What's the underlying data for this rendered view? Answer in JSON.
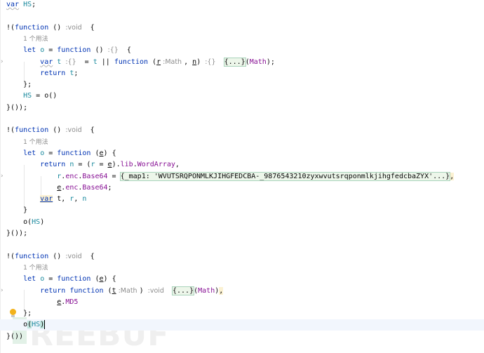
{
  "code": {
    "lines": [
      {
        "tokens": [
          {
            "t": "var",
            "c": "kw wavy"
          },
          {
            "t": " "
          },
          {
            "t": "HS",
            "c": "g"
          },
          {
            "t": ";"
          }
        ]
      },
      {
        "tokens": []
      },
      {
        "tokens": [
          {
            "t": "!("
          },
          {
            "t": "function",
            "c": "kw"
          },
          {
            "t": " () "
          },
          {
            "t": ":void",
            "c": "hint"
          },
          {
            "t": "  {"
          }
        ]
      },
      {
        "indent": 4,
        "tokens": [
          {
            "t": "1 个用法",
            "c": "usage"
          }
        ]
      },
      {
        "indent": 4,
        "tokens": [
          {
            "t": "let",
            "c": "kw"
          },
          {
            "t": " "
          },
          {
            "t": "o",
            "c": "g"
          },
          {
            "t": " = "
          },
          {
            "t": "function",
            "c": "kw"
          },
          {
            "t": " () "
          },
          {
            "t": ":{}",
            "c": "hint"
          },
          {
            "t": "  {"
          }
        ]
      },
      {
        "indent": 8,
        "fold": true,
        "tokens": [
          {
            "t": "var",
            "c": "kw wavy"
          },
          {
            "t": " "
          },
          {
            "t": "t",
            "c": "g"
          },
          {
            "t": " "
          },
          {
            "t": ":{}",
            "c": "hint"
          },
          {
            "t": "  = "
          },
          {
            "t": "t",
            "c": "g"
          },
          {
            "t": " || "
          },
          {
            "t": "function",
            "c": "kw"
          },
          {
            "t": " ("
          },
          {
            "t": "r",
            "c": "u"
          },
          {
            "t": " :Math ",
            "c": "hint"
          },
          {
            "t": ", "
          },
          {
            "t": "n",
            "c": "u"
          },
          {
            "t": ") "
          },
          {
            "t": ":{}",
            "c": "hint"
          },
          {
            "t": "  "
          },
          {
            "t": "{...}",
            "c": "fold"
          },
          {
            "t": "("
          },
          {
            "t": "Math",
            "c": "p"
          },
          {
            "t": ");"
          }
        ]
      },
      {
        "indent": 8,
        "tokens": [
          {
            "t": "return",
            "c": "kw"
          },
          {
            "t": " "
          },
          {
            "t": "t",
            "c": "g"
          },
          {
            "t": ";"
          }
        ]
      },
      {
        "indent": 4,
        "tokens": [
          {
            "t": "};"
          }
        ]
      },
      {
        "indent": 4,
        "tokens": [
          {
            "t": "HS",
            "c": "g"
          },
          {
            "t": " = "
          },
          {
            "t": "o",
            "c": "id"
          },
          {
            "t": "()"
          }
        ]
      },
      {
        "tokens": [
          {
            "t": "}());"
          }
        ]
      },
      {
        "tokens": []
      },
      {
        "tokens": [
          {
            "t": "!("
          },
          {
            "t": "function",
            "c": "kw"
          },
          {
            "t": " () "
          },
          {
            "t": ":void",
            "c": "hint"
          },
          {
            "t": "  {"
          }
        ]
      },
      {
        "indent": 4,
        "tokens": [
          {
            "t": "1 个用法",
            "c": "usage"
          }
        ]
      },
      {
        "indent": 4,
        "tokens": [
          {
            "t": "let",
            "c": "kw"
          },
          {
            "t": " "
          },
          {
            "t": "o",
            "c": "g"
          },
          {
            "t": " = "
          },
          {
            "t": "function",
            "c": "kw"
          },
          {
            "t": " ("
          },
          {
            "t": "e",
            "c": "u"
          },
          {
            "t": ") {"
          }
        ]
      },
      {
        "indent": 8,
        "tokens": [
          {
            "t": "return",
            "c": "kw"
          },
          {
            "t": " "
          },
          {
            "t": "n",
            "c": "g"
          },
          {
            "t": " = ("
          },
          {
            "t": "r",
            "c": "g"
          },
          {
            "t": " = "
          },
          {
            "t": "e",
            "c": "u"
          },
          {
            "t": ")."
          },
          {
            "t": "lib",
            "c": "p"
          },
          {
            "t": "."
          },
          {
            "t": "WordArray",
            "c": "p"
          },
          {
            "t": ","
          }
        ]
      },
      {
        "indent": 12,
        "fold": true,
        "tokens": [
          {
            "t": "r",
            "c": "g"
          },
          {
            "t": "."
          },
          {
            "t": "enc",
            "c": "p"
          },
          {
            "t": "."
          },
          {
            "t": "Base64",
            "c": "p"
          },
          {
            "t": " = "
          },
          {
            "t": "{_map1: 'WVUTSRQPONMLKJIHGFEDCBA-_9876543210zyxwvutsrqponmlkjihgfedcbaZYX'...}",
            "c": "fold"
          },
          {
            "t": ",",
            "c": "y"
          }
        ]
      },
      {
        "indent": 12,
        "tokens": [
          {
            "t": "e",
            "c": "u"
          },
          {
            "t": "."
          },
          {
            "t": "enc",
            "c": "p"
          },
          {
            "t": "."
          },
          {
            "t": "Base64",
            "c": "p"
          },
          {
            "t": ";"
          }
        ]
      },
      {
        "indent": 8,
        "tokens": [
          {
            "t": "var",
            "c": "kw ybox"
          },
          {
            "t": " "
          },
          {
            "t": "t",
            "c": "id"
          },
          {
            "t": ", "
          },
          {
            "t": "r",
            "c": "g"
          },
          {
            "t": ", "
          },
          {
            "t": "n",
            "c": "g"
          }
        ]
      },
      {
        "indent": 4,
        "tokens": [
          {
            "t": "}"
          }
        ]
      },
      {
        "indent": 4,
        "tokens": [
          {
            "t": "o",
            "c": "id"
          },
          {
            "t": "("
          },
          {
            "t": "HS",
            "c": "g"
          },
          {
            "t": ")"
          }
        ]
      },
      {
        "tokens": [
          {
            "t": "}());"
          }
        ]
      },
      {
        "tokens": []
      },
      {
        "tokens": [
          {
            "t": "!("
          },
          {
            "t": "function",
            "c": "kw"
          },
          {
            "t": " () "
          },
          {
            "t": ":void",
            "c": "hint"
          },
          {
            "t": "  {"
          }
        ]
      },
      {
        "indent": 4,
        "tokens": [
          {
            "t": "1 个用法",
            "c": "usage"
          }
        ]
      },
      {
        "indent": 4,
        "tokens": [
          {
            "t": "let",
            "c": "kw"
          },
          {
            "t": " "
          },
          {
            "t": "o",
            "c": "g"
          },
          {
            "t": " = "
          },
          {
            "t": "function",
            "c": "kw"
          },
          {
            "t": " ("
          },
          {
            "t": "e",
            "c": "u"
          },
          {
            "t": ") {"
          }
        ]
      },
      {
        "indent": 8,
        "fold": true,
        "tokens": [
          {
            "t": "return",
            "c": "kw"
          },
          {
            "t": " "
          },
          {
            "t": "function",
            "c": "kw"
          },
          {
            "t": " ("
          },
          {
            "t": "t",
            "c": "u"
          },
          {
            "t": " :Math ",
            "c": "hint"
          },
          {
            "t": ") "
          },
          {
            "t": ":void",
            "c": "hint"
          },
          {
            "t": "  "
          },
          {
            "t": "{...}",
            "c": "fold"
          },
          {
            "t": "("
          },
          {
            "t": "Math",
            "c": "p"
          },
          {
            "t": ")"
          },
          {
            "t": ",",
            "c": "y"
          }
        ]
      },
      {
        "indent": 12,
        "tokens": [
          {
            "t": "e",
            "c": "u"
          },
          {
            "t": "."
          },
          {
            "t": "MD5",
            "c": "p"
          }
        ]
      },
      {
        "indent": 4,
        "bulb": true,
        "tokens": [
          {
            "t": "};"
          }
        ]
      },
      {
        "indent": 4,
        "current": true,
        "caret": true,
        "tokens": [
          {
            "t": "o",
            "c": "id"
          },
          {
            "t": "(",
            "c": "brace"
          },
          {
            "t": "HS",
            "c": "g"
          },
          {
            "t": ")",
            "c": "brace"
          }
        ]
      },
      {
        "tokens": [
          {
            "t": "}())"
          }
        ]
      }
    ]
  },
  "gutter": {
    "fold_icon": "chevron-right-icon",
    "intention_icon": "lightbulb-icon"
  },
  "watermark": "REEBUF",
  "colors": {
    "keyword": "#0033b3",
    "global": "#1b8a9e",
    "property": "#871094",
    "hint": "#8c8c8c",
    "current_line": "#f2f6fd"
  }
}
